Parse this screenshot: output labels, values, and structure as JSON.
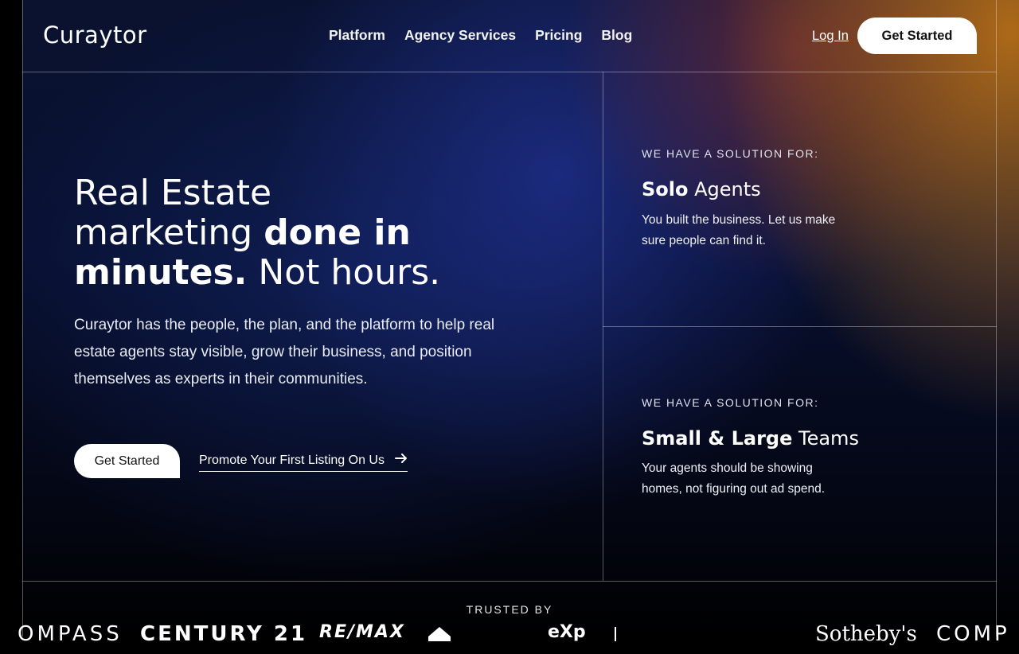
{
  "brand": {
    "logo_text": "Curaytor"
  },
  "nav": {
    "items": [
      "Platform",
      "Agency Services",
      "Pricing",
      "Blog"
    ],
    "login": "Log In",
    "cta": "Get Started"
  },
  "hero": {
    "title_line1": "Real Estate",
    "title_line2_regular": "marketing ",
    "title_line2_bold": "done in",
    "title_line3_bold": "minutes.",
    "title_line3_regular": " Not hours.",
    "description": "Curaytor has the people, the plan, and the platform to help real estate agents stay visible, grow their business, and position themselves as experts in their communities.",
    "cta": "Get Started",
    "promo_link": "Promote Your First Listing On Us"
  },
  "solutions": [
    {
      "kicker": "WE HAVE A SOLUTION FOR:",
      "title_bold": "Solo",
      "title_regular": " Agents",
      "description": "You built the business. Let us make sure people can find it."
    },
    {
      "kicker": "WE HAVE A SOLUTION FOR:",
      "title_bold": "Small & Large",
      "title_regular": " Teams",
      "description": "Your agents should be showing homes, not figuring out ad spend."
    }
  ],
  "trusted": {
    "label": "TRUSTED BY",
    "logos": [
      "OMPASS",
      "CENTURY 21",
      "RE/MAX",
      "eXp",
      "Sotheby's",
      "COMP"
    ]
  },
  "colors": {
    "accent_orange": "#c87814",
    "accent_blue": "#283cb4",
    "background": "#03050f"
  },
  "icons": {
    "promo_arrow": "arrow-right-icon",
    "house": "house-icon"
  }
}
